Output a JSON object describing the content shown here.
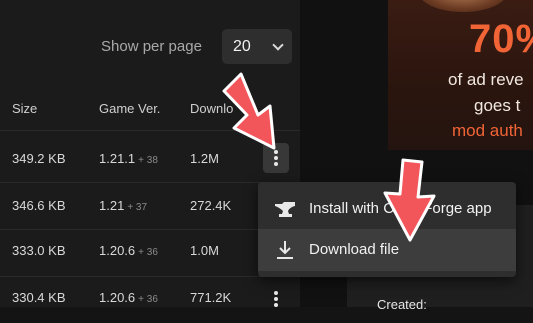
{
  "pagination": {
    "per_page_label": "Show per page",
    "per_page_value": "20"
  },
  "table": {
    "headers": {
      "size": "Size",
      "game_version": "Game Ver.",
      "downloads": "Downlo"
    },
    "rows": [
      {
        "size": "349.2 KB",
        "version": "1.21.1",
        "extra": "+ 38",
        "downloads": "1.2M"
      },
      {
        "size": "346.6 KB",
        "version": "1.21",
        "extra": "+ 37",
        "downloads": "272.4K"
      },
      {
        "size": "333.0 KB",
        "version": "1.20.6",
        "extra": "+ 36",
        "downloads": "1.0M"
      },
      {
        "size": "330.4 KB",
        "version": "1.20.6",
        "extra": "+ 36",
        "downloads": "771.2K"
      }
    ]
  },
  "menu": {
    "install_label": "Install with CurseForge app",
    "download_label": "Download file",
    "install_icon": "anvil-icon",
    "download_icon": "download-icon"
  },
  "promo": {
    "percent": "70%",
    "line1": "of ad reve",
    "line2": "goes t",
    "line3": "mod auth"
  },
  "info": {
    "created_label": "Created:"
  },
  "colors": {
    "accent": "#f16436",
    "arrow": "#f2555a",
    "background": "#141414"
  }
}
